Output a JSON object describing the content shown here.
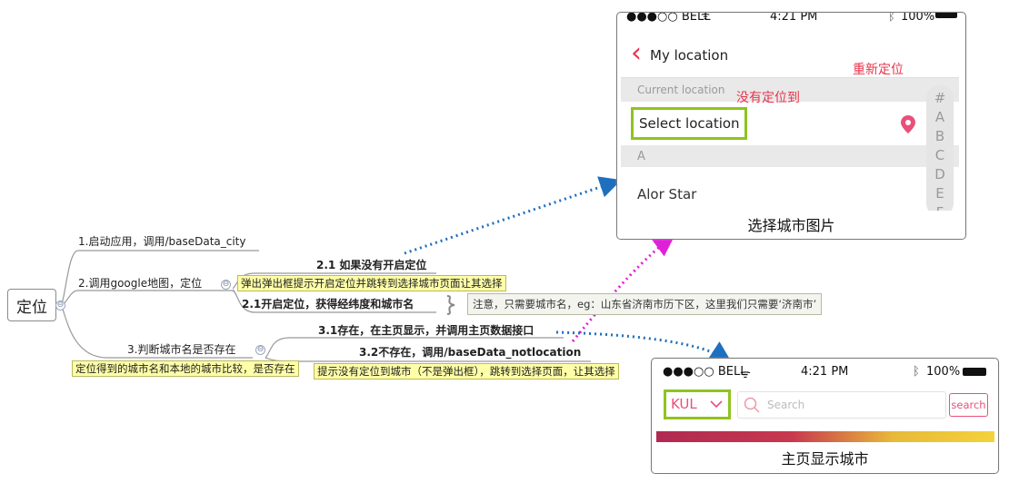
{
  "root": {
    "label": "定位"
  },
  "branches": [
    {
      "label": "1.启动应用，调用/baseData_city"
    },
    {
      "label": "2.调用google地图，定位"
    },
    {
      "label": "3.判断城市名是否存在"
    }
  ],
  "notes": {
    "n2": "弹出弹出框提示开启定位并跳转到选择城市页面让其选择",
    "n3": "定位得到的城市名和本地的城市比较，是否存在",
    "n32": "提示没有定位到城市（不是弹出框），跳转到选择页面，让其选择",
    "hint": "注意，只需要城市名，eg：山东省济南市历下区，这里我们只需要‘济南市’"
  },
  "sub_branches": {
    "b21a": "2.1 如果没有开启定位",
    "b21b": "2.1开启定位，获得经纬度和城市名",
    "b31": "3.1存在，在主页显示，并调用主页数据接口",
    "b32": "3.2不存在，调用/baseData_notlocation"
  },
  "city_phone": {
    "status": {
      "carrier": "●●●○○ BELL",
      "time": "4:21 PM",
      "battery": "100%"
    },
    "back_symbol": "‹",
    "title": "My location",
    "section_current": "Current location",
    "select_location": "Select location",
    "section_a": "A",
    "first_city": "Alor Star",
    "index_letters": [
      "#",
      "A",
      "B",
      "C",
      "D",
      "E",
      "F"
    ],
    "annotation_relocate": "重新定位",
    "annotation_not_located": "没有定位到",
    "caption": "选择城市图片"
  },
  "home_phone": {
    "status": {
      "carrier": "●●●○○ BELL",
      "time": "4:21 PM",
      "battery": "100%"
    },
    "city": "KUL",
    "search_placeholder": "Search",
    "search_button": "search",
    "caption": "主页显示城市"
  },
  "colors": {
    "accent_red": "#e8334a",
    "pink": "#e8507a",
    "green": "#8fc320",
    "blue_arrow": "#1f6fbf",
    "magenta_arrow": "#e020d8"
  },
  "icons": [
    "collapse-icon",
    "back-chevron-icon",
    "location-pin-icon",
    "search-icon",
    "chevron-down-icon",
    "wifi-icon",
    "bluetooth-icon",
    "battery-icon"
  ]
}
